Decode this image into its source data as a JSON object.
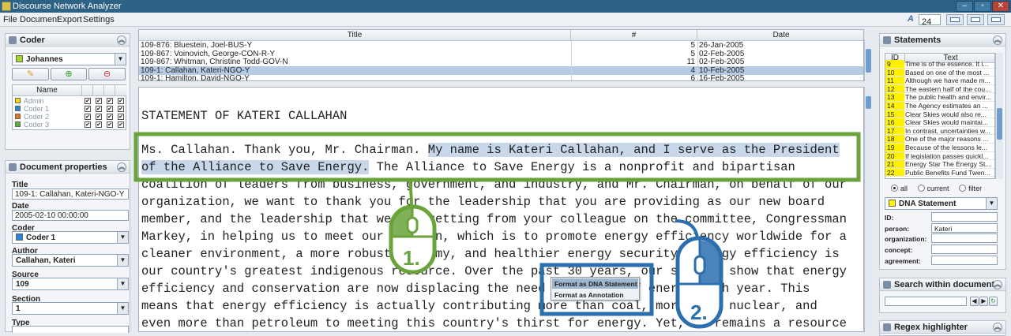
{
  "window": {
    "title": "Discourse Network Analyzer"
  },
  "menu": [
    "File",
    "Document",
    "Export",
    "Settings"
  ],
  "toolbar": {
    "zoom": "24"
  },
  "coder": {
    "header": "Coder",
    "selected": "Johannes",
    "selected_color": "#a6d82b",
    "table_header": "Name",
    "rows": [
      {
        "name": "Admin",
        "color": "#ffd800"
      },
      {
        "name": "Coder 1",
        "color": "#2c82d6"
      },
      {
        "name": "Coder 2",
        "color": "#e8741a"
      },
      {
        "name": "Coder 3",
        "color": "#57b23a"
      }
    ]
  },
  "doc_props": {
    "header": "Document properties",
    "title_label": "Title",
    "title_value": "109-1: Callahan, Kateri-NGO-Y",
    "date_label": "Date",
    "date_value": "2005-02-10  00:00:00",
    "coder_label": "Coder",
    "coder_value": "Coder 1",
    "author_label": "Author",
    "author_value": "Callahan, Kateri",
    "source_label": "Source",
    "source_value": "109",
    "section_label": "Section",
    "section_value": "1",
    "type_label": "Type"
  },
  "documents": {
    "columns": [
      "Title",
      "#",
      "Date"
    ],
    "rows": [
      {
        "title": "109-876: Bluestein, Joel-BUS-Y",
        "num": "5",
        "date": "26-Jan-2005",
        "sel": false
      },
      {
        "title": "109-867: Voinovich, George-CON-R-Y",
        "num": "5",
        "date": "02-Feb-2005",
        "sel": false
      },
      {
        "title": "109-867: Whitman, Christine Todd-GOV-N",
        "num": "11",
        "date": "02-Feb-2005",
        "sel": false
      },
      {
        "title": "109-1: Callahan, Kateri-NGO-Y",
        "num": "4",
        "date": "10-Feb-2005",
        "sel": true
      },
      {
        "title": "109-1: Hamilton, David-NGO-Y",
        "num": "6",
        "date": "16-Feb-2005",
        "sel": false
      }
    ]
  },
  "text": {
    "heading": "STATEMENT OF KATERI CALLAHAN",
    "l1a": "Ms. Callahan. Thank you, Mr. Chairman. ",
    "l1b": "My name is Kateri Callahan, and I serve as the President",
    "l2a": "of the Alliance to Save Energy.",
    "l2b": " The Alliance to Save Energy is a nonprofit and bipartisan",
    "lines": [
      "coalition of leaders from business, government, and industry, and Mr. Chairman, on behalf of our",
      "organization, we want to thank you for the leadership that you are providing as our new board",
      "member, and the leadership that we are getting from your colleague on the committee, Congressman",
      "Markey, in helping us to meet our mission, which is to promote energy efficiency worldwide for a",
      "cleaner environment, a more robust economy, and healthier energy security. Energy efficiency is",
      "our country's greatest indigenous resource. Over the past 30 years, our studies show that energy",
      "efficiency and conservation are now displacing the need for quads of energy each year. This",
      "means that energy efficiency is actually contributing more than coal, more than nuclear, and",
      "even more than petroleum to meeting this country's thirst for energy. Yet, it remains a resource"
    ]
  },
  "popup": {
    "item1": "Format as DNA Statement",
    "item2": "Format as Annotation"
  },
  "steps": {
    "one": "1.",
    "two": "2."
  },
  "statements": {
    "header": "Statements",
    "col_id": "ID",
    "col_text": "Text",
    "rows": [
      {
        "id": "9",
        "text": "Time is of the essence. It i..."
      },
      {
        "id": "10",
        "text": "Based on one of the most ..."
      },
      {
        "id": "11",
        "text": "Although we have made m..."
      },
      {
        "id": "12",
        "text": "The eastern half of the cou..."
      },
      {
        "id": "13",
        "text": "The public health and envir..."
      },
      {
        "id": "14",
        "text": "The Agency estimates an ..."
      },
      {
        "id": "15",
        "text": "Clear Skies would also re..."
      },
      {
        "id": "16",
        "text": "Clear Skies would maintai..."
      },
      {
        "id": "17",
        "text": "In contrast, uncertainties w..."
      },
      {
        "id": "18",
        "text": "One of the major reasons ..."
      },
      {
        "id": "19",
        "text": "Because of the lessons le..."
      },
      {
        "id": "20",
        "text": "If legislation passes quickl..."
      },
      {
        "id": "21",
        "text": "Energy Star The Energy St..."
      },
      {
        "id": "22",
        "text": "Public Benefits Fund Twen..."
      }
    ],
    "filter_all": "all",
    "filter_current": "current",
    "filter_filter": "filter",
    "type_selected": "DNA Statement",
    "fields": {
      "id": "ID:",
      "person": "person:",
      "person_value": "Kateri",
      "organization": "organization:",
      "concept": "concept:",
      "agreement": "agreement:"
    }
  },
  "search": {
    "header": "Search within document"
  },
  "regex": {
    "header": "Regex highlighter"
  },
  "colors": {
    "green": "#6aa23b",
    "blue": "#2c6fae",
    "selection": "#c8d8ea",
    "statement_id": "#fff200"
  }
}
